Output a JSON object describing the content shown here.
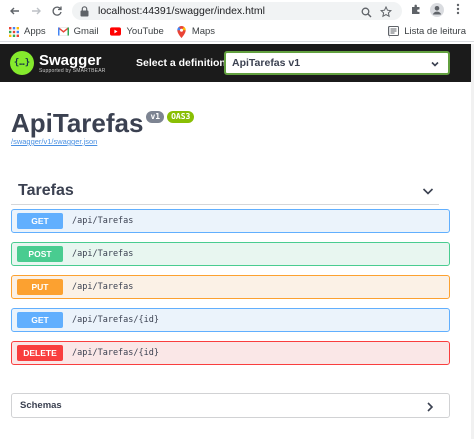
{
  "browser": {
    "url": "localhost:44391/swagger/index.html",
    "bookmarks": [
      {
        "label": "Apps",
        "icon": "apps-grid-icon"
      },
      {
        "label": "Gmail",
        "icon": "gmail-icon"
      },
      {
        "label": "YouTube",
        "icon": "youtube-icon"
      },
      {
        "label": "Maps",
        "icon": "maps-icon"
      }
    ],
    "reading_list_label": "Lista de leitura"
  },
  "topbar": {
    "logo_name": "Swagger",
    "logo_sub": "Supported by SMARTBEAR",
    "definition_label": "Select a definition",
    "definition_value": "ApiTarefas v1"
  },
  "info": {
    "title": "ApiTarefas",
    "version_badge": "v1",
    "oas_badge": "OAS3",
    "spec_link": "/swagger/v1/swagger.json"
  },
  "tag": {
    "name": "Tarefas"
  },
  "operations": [
    {
      "method": "GET",
      "path": "/api/Tarefas"
    },
    {
      "method": "POST",
      "path": "/api/Tarefas"
    },
    {
      "method": "PUT",
      "path": "/api/Tarefas"
    },
    {
      "method": "GET",
      "path": "/api/Tarefas/{id}"
    },
    {
      "method": "DELETE",
      "path": "/api/Tarefas/{id}"
    }
  ],
  "schemas": {
    "label": "Schemas"
  },
  "colors": {
    "get": "#61affe",
    "post": "#49cc90",
    "put": "#fca130",
    "delete": "#f93e3e",
    "swagger_green": "#85ea2d"
  }
}
